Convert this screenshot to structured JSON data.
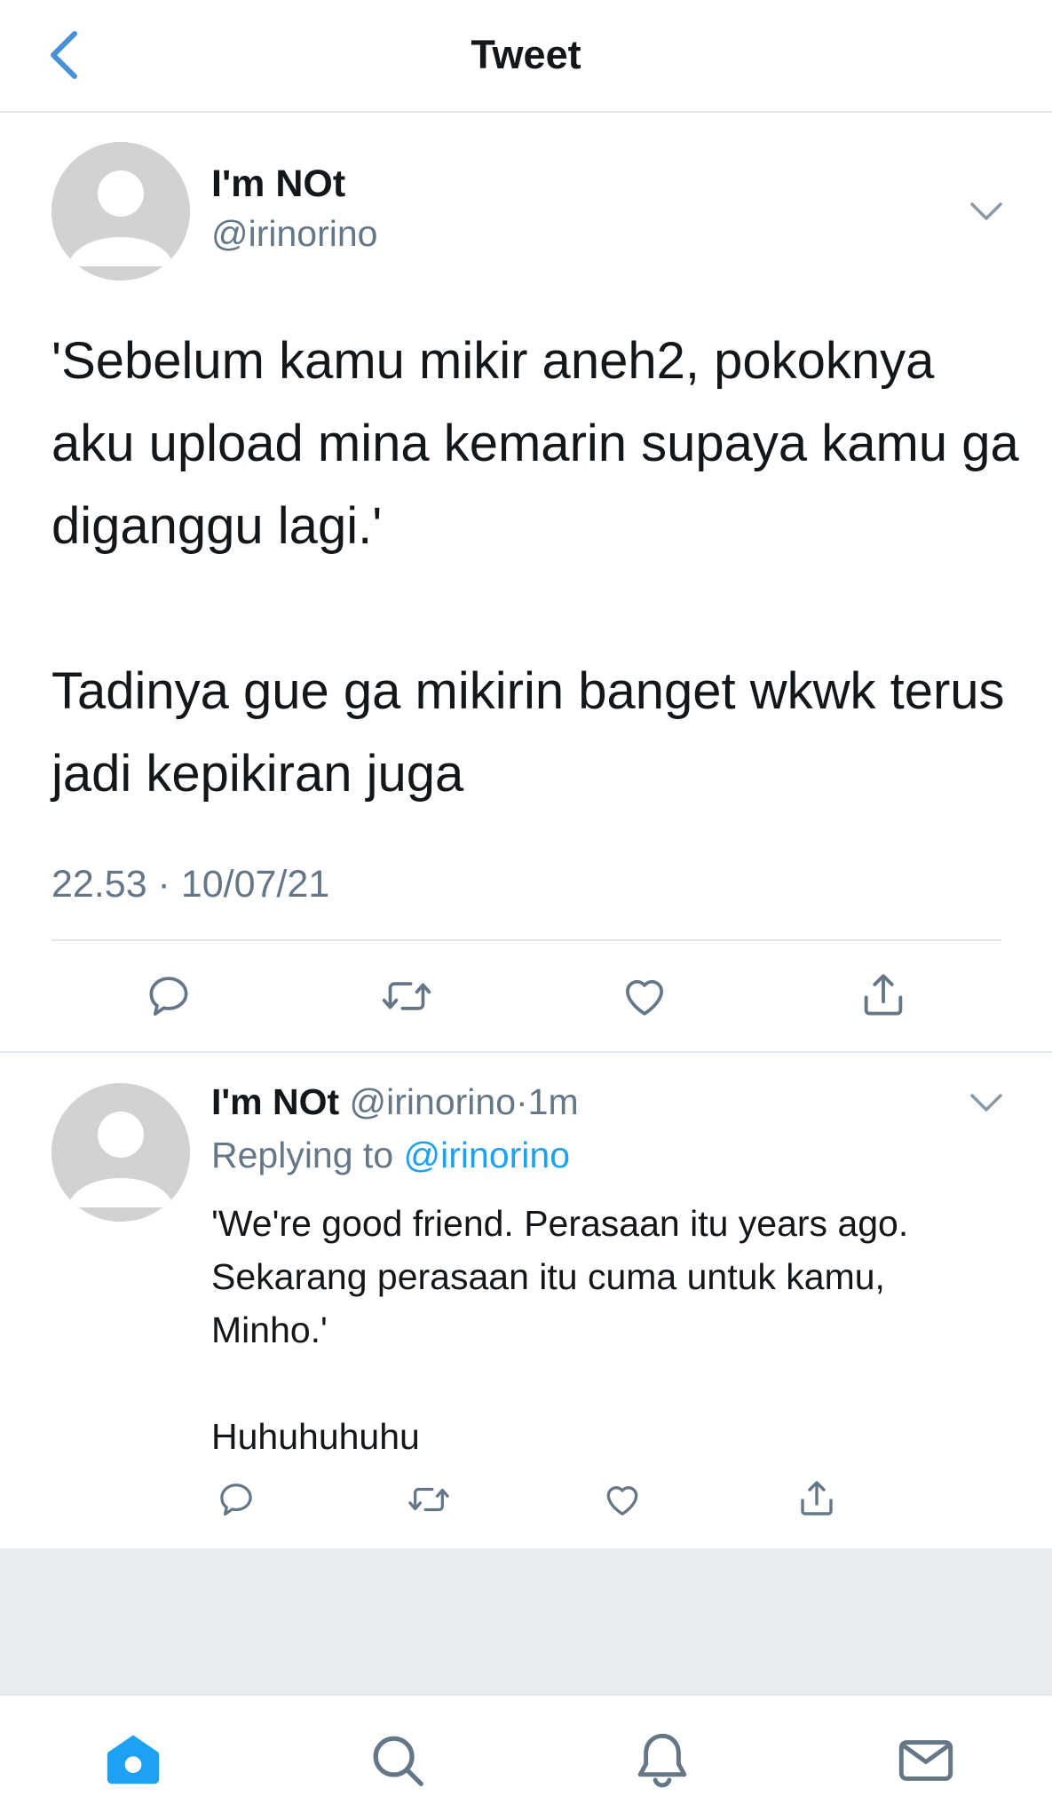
{
  "header": {
    "title": "Tweet",
    "back_icon": "chevron-left-icon"
  },
  "tweet": {
    "author_name": "I'm NOt",
    "author_handle": "@irinorino",
    "text": "'Sebelum kamu mikir aneh2, pokoknya aku upload mina kemarin supaya kamu ga diganggu lagi.'\n\nTadinya gue ga mikirin banget wkwk terus jadi kepikiran juga",
    "timestamp": "22.53 · 10/07/21"
  },
  "reply": {
    "author_name": "I'm NOt",
    "author_handle": "@irinorino",
    "separator": "·",
    "time": "1m",
    "replying_prefix": "Replying to",
    "replying_handle": "@irinorino",
    "text": "'We're good friend. Perasaan itu years ago. Sekarang perasaan itu cuma untuk kamu, Minho.'\n\nHuhuhuhuhu"
  },
  "tabbar": {
    "tabs": [
      "home-icon",
      "search-icon",
      "notifications-icon",
      "messages-icon"
    ],
    "active": "home-icon"
  },
  "colors": {
    "accent": "#1da1f2",
    "back_chevron": "#4a90d9",
    "secondary_text": "#657786",
    "icon_gray": "#657786",
    "divider": "#e1e8ed",
    "avatar": "#d2d2d2"
  }
}
